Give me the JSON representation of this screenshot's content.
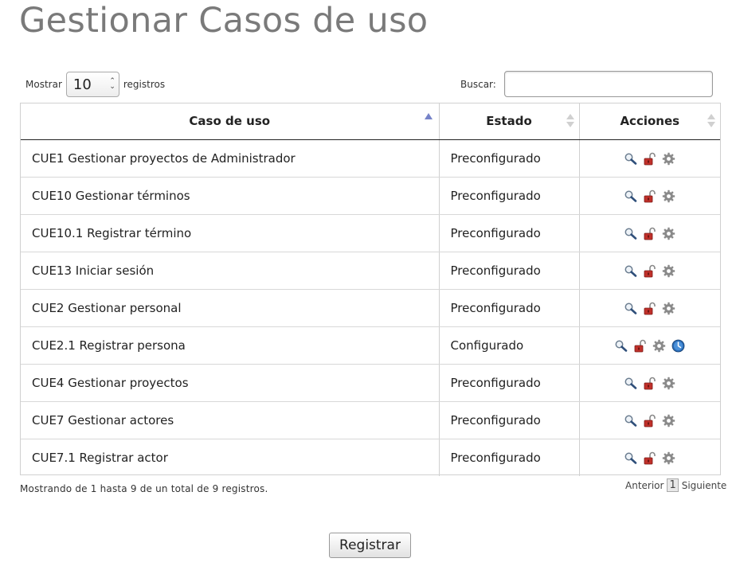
{
  "page_title": "Gestionar Casos de uso",
  "length_control": {
    "prefix": "Mostrar",
    "selected": "10",
    "suffix": "registros"
  },
  "search": {
    "label": "Buscar:",
    "value": ""
  },
  "table": {
    "columns": [
      "Caso de uso",
      "Estado",
      "Acciones"
    ],
    "sort": {
      "column": "Caso de uso",
      "direction": "asc"
    },
    "rows": [
      {
        "caso": "CUE1 Gestionar proyectos de Administrador",
        "estado": "Preconfigurado",
        "actions": [
          "view-icon",
          "unlock-icon",
          "gear-icon"
        ]
      },
      {
        "caso": "CUE10 Gestionar términos",
        "estado": "Preconfigurado",
        "actions": [
          "view-icon",
          "unlock-icon",
          "gear-icon"
        ]
      },
      {
        "caso": "CUE10.1 Registrar término",
        "estado": "Preconfigurado",
        "actions": [
          "view-icon",
          "unlock-icon",
          "gear-icon"
        ]
      },
      {
        "caso": "CUE13 Iniciar sesión",
        "estado": "Preconfigurado",
        "actions": [
          "view-icon",
          "unlock-icon",
          "gear-icon"
        ]
      },
      {
        "caso": "CUE2 Gestionar personal",
        "estado": "Preconfigurado",
        "actions": [
          "view-icon",
          "unlock-icon",
          "gear-icon"
        ]
      },
      {
        "caso": "CUE2.1 Registrar persona",
        "estado": "Configurado",
        "actions": [
          "view-icon",
          "unlock-icon",
          "gear-icon",
          "globe-icon"
        ]
      },
      {
        "caso": "CUE4 Gestionar proyectos",
        "estado": "Preconfigurado",
        "actions": [
          "view-icon",
          "unlock-icon",
          "gear-icon"
        ]
      },
      {
        "caso": "CUE7 Gestionar actores",
        "estado": "Preconfigurado",
        "actions": [
          "view-icon",
          "unlock-icon",
          "gear-icon"
        ]
      },
      {
        "caso": "CUE7.1 Registrar actor",
        "estado": "Preconfigurado",
        "actions": [
          "view-icon",
          "unlock-icon",
          "gear-icon"
        ]
      }
    ]
  },
  "info_text": "Mostrando de 1 hasta 9 de un total de 9 registros.",
  "pagination": {
    "previous": "Anterior",
    "current": "1",
    "next": "Siguiente"
  },
  "submit_label": "Registrar",
  "colors": {
    "title": "#7a7a7a",
    "sort_active": "#7683c8",
    "lock": "#c0302a",
    "globe": "#2a6db8"
  }
}
